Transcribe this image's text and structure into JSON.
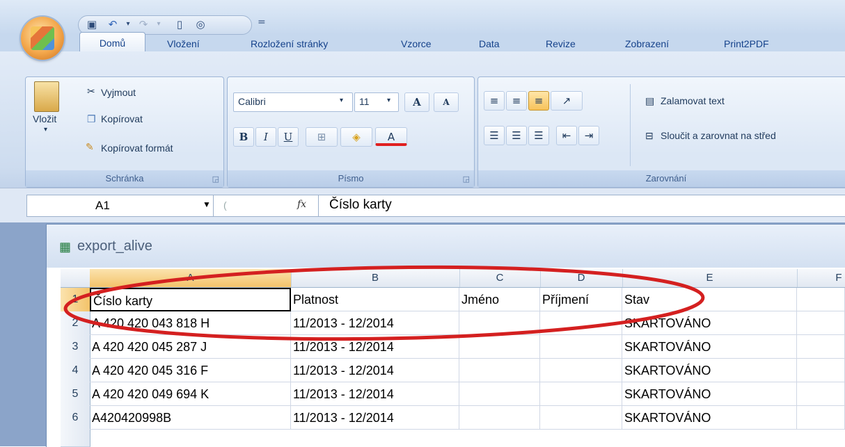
{
  "quick_access": {
    "save_icon": "save-icon",
    "undo_icon": "undo-icon",
    "redo_icon": "redo-icon",
    "new_icon": "new-document-icon",
    "preview_icon": "print-preview-icon",
    "customize": "="
  },
  "tabs": [
    "Domů",
    "Vložení",
    "Rozložení stránky",
    "Vzorce",
    "Data",
    "Revize",
    "Zobrazení",
    "Print2PDF"
  ],
  "clipboard": {
    "paste": "Vložit",
    "cut": "Vyjmout",
    "copy": "Kopírovat",
    "format_painter": "Kopírovat formát",
    "label": "Schránka"
  },
  "font": {
    "name": "Calibri",
    "size": "11",
    "bold": "B",
    "italic": "I",
    "underline": "U",
    "color_glyph": "A",
    "grow": "A",
    "shrink": "A",
    "label": "Písmo"
  },
  "alignment": {
    "wrap": "Zalamovat text",
    "merge": "Sloučit a zarovnat na střed",
    "label": "Zarovnání"
  },
  "formula_bar": {
    "name_box": "A1",
    "fx": "fx",
    "value": "Číslo karty"
  },
  "workbook": {
    "title": "export_alive"
  },
  "columns": [
    "A",
    "B",
    "C",
    "D",
    "E",
    "F"
  ],
  "rows": [
    {
      "num": "1",
      "cells": [
        "Číslo karty",
        "Platnost",
        "Jméno",
        "Příjmení",
        "Stav",
        ""
      ]
    },
    {
      "num": "2",
      "cells": [
        "A 420 420 043 818 H",
        "11/2013 - 12/2014",
        "",
        "",
        "SKARTOVÁNO",
        ""
      ]
    },
    {
      "num": "3",
      "cells": [
        "A 420 420 045 287 J",
        "11/2013 - 12/2014",
        "",
        "",
        "SKARTOVÁNO",
        ""
      ]
    },
    {
      "num": "4",
      "cells": [
        "A 420 420 045 316 F",
        "11/2013 - 12/2014",
        "",
        "",
        "SKARTOVÁNO",
        ""
      ]
    },
    {
      "num": "5",
      "cells": [
        "A 420 420 049 694 K",
        "11/2013 - 12/2014",
        "",
        "",
        "SKARTOVÁNO",
        ""
      ]
    },
    {
      "num": "6",
      "cells": [
        "A420420998B",
        "11/2013 - 12/2014",
        "",
        "",
        "SKARTOVÁNO",
        ""
      ]
    }
  ],
  "colors": {
    "annotation": "#d42020",
    "ribbon": "#dce7f5",
    "selected_header": "#f9d58a"
  }
}
